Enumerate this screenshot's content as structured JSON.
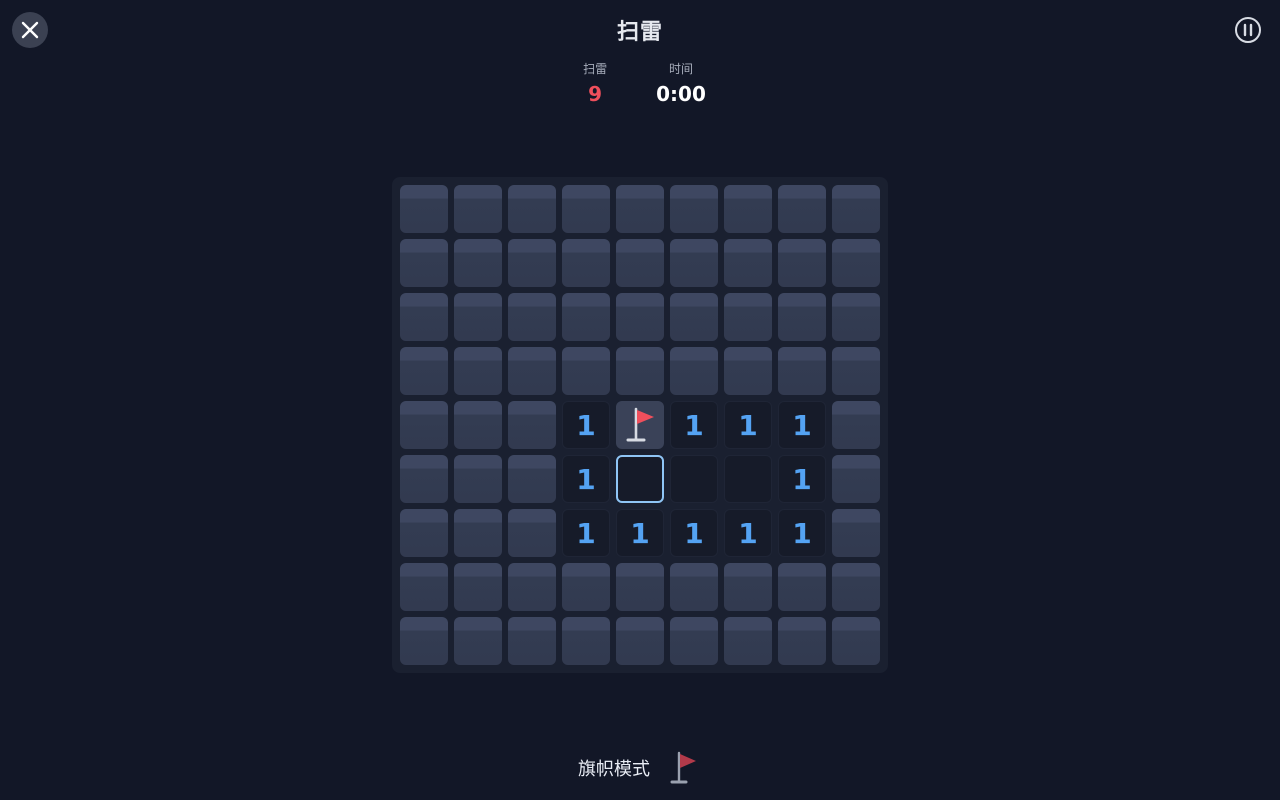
{
  "header": {
    "title": "扫雷",
    "close_icon": "close-icon",
    "pause_icon": "pause-icon"
  },
  "stats": {
    "mines_label": "扫雷",
    "mines_value": "9",
    "time_label": "时间",
    "time_value": "0:00"
  },
  "board": {
    "rows": 9,
    "cols": 9,
    "grid": [
      [
        "H",
        "H",
        "H",
        "H",
        "H",
        "H",
        "H",
        "H",
        "H"
      ],
      [
        "H",
        "H",
        "H",
        "H",
        "H",
        "H",
        "H",
        "H",
        "H"
      ],
      [
        "H",
        "H",
        "H",
        "H",
        "H",
        "H",
        "H",
        "H",
        "H"
      ],
      [
        "H",
        "H",
        "H",
        "H",
        "H",
        "H",
        "H",
        "H",
        "H"
      ],
      [
        "H",
        "H",
        "H",
        "1",
        "F",
        "1",
        "1",
        "1",
        "H"
      ],
      [
        "H",
        "H",
        "H",
        "1",
        "S",
        "E",
        "E",
        "1",
        "H"
      ],
      [
        "H",
        "H",
        "H",
        "1",
        "1",
        "1",
        "1",
        "1",
        "H"
      ],
      [
        "H",
        "H",
        "H",
        "H",
        "H",
        "H",
        "H",
        "H",
        "H"
      ],
      [
        "H",
        "H",
        "H",
        "H",
        "H",
        "H",
        "H",
        "H",
        "H"
      ]
    ],
    "legend": {
      "H": "hidden",
      "F": "flagged",
      "S": "selected-empty",
      "E": "revealed-empty",
      "number": "revealed-count"
    }
  },
  "colors": {
    "background": "#121727",
    "number": "#54a3f3",
    "mines": "#ef4f5c",
    "flag": "#ef4f5c",
    "selected_border": "#8fc5f5"
  },
  "footer": {
    "flag_mode_label": "旗帜模式",
    "flag_mode_icon": "flag-icon"
  }
}
